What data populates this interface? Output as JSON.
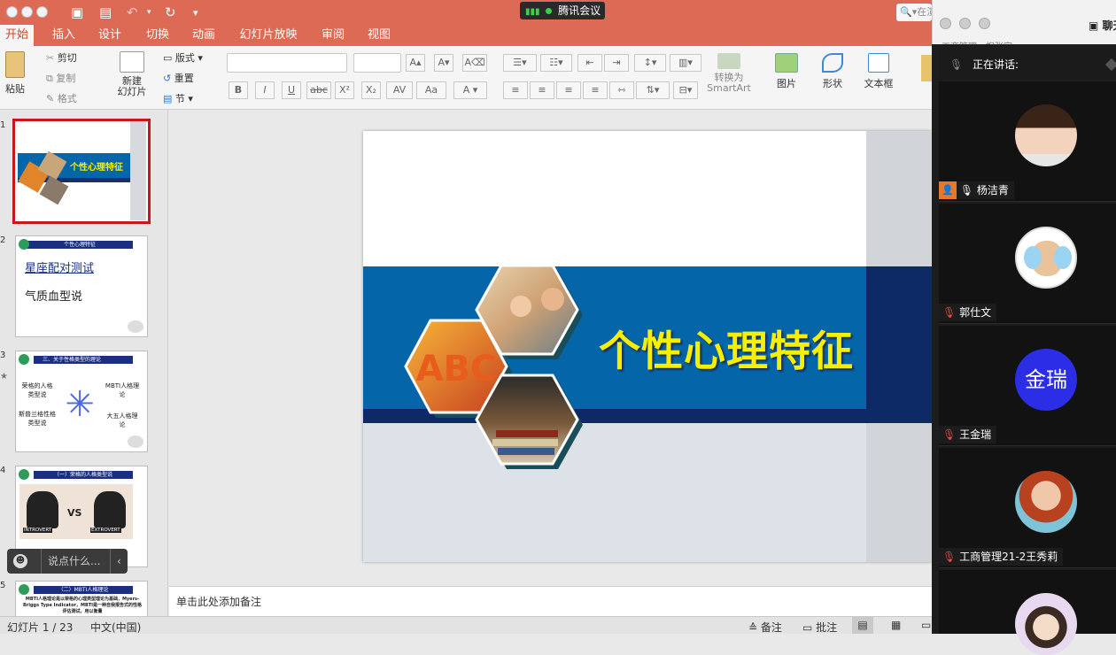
{
  "meeting": {
    "indicator_label": "腾讯会议",
    "speaking_label": "正在讲话:",
    "chat_label": "聊天",
    "search_placeholder": "在演示文稿中搜索",
    "name_strip": "工商管理 - 祝张宇"
  },
  "ribbon_tabs": [
    "开始",
    "插入",
    "设计",
    "切换",
    "动画",
    "幻灯片放映",
    "审阅",
    "视图"
  ],
  "ribbon": {
    "paste": "粘贴",
    "cut": "剪切",
    "copy": "复制",
    "format": "格式",
    "new_slide": "新建\n幻灯片",
    "layout": "版式",
    "reset": "重置",
    "section": "节",
    "convert": "转换为\nSmartArt",
    "picture": "图片",
    "shape": "形状",
    "textbox": "文本框"
  },
  "slides": [
    {
      "num": "1",
      "title": "个性心理特征"
    },
    {
      "num": "2",
      "header": "个性心理特征",
      "line1": "星座配对测试",
      "line2": "气质血型说"
    },
    {
      "num": "3",
      "header": "三、关于性格类型的理论",
      "items": [
        "荣格的人格类型说",
        "MBTI人格理论",
        "斯普兰格性格类型说",
        "大五人格理论"
      ]
    },
    {
      "num": "4",
      "header": "（一）荣格的人格类型说",
      "left": "INTROVERT",
      "right": "EXTROVERT",
      "vs": "VS"
    },
    {
      "num": "5",
      "header": "（二）MBTI人格理论",
      "body": "MBTI人格理论是以荣格的心理类型理论为基础，Myers-Briggs Type Indicator，MBTI是一种自我报告式的性格评估测试，用以衡量"
    }
  ],
  "main_slide_title": "个性心理特征",
  "chat_box_placeholder": "说点什么...",
  "notes_placeholder": "单击此处添加备注",
  "status": {
    "slide_counter": "幻灯片 1 / 23",
    "language": "中文(中国)",
    "notes_btn": "备注",
    "comments_btn": "批注"
  },
  "participants": [
    {
      "name": "杨洁青",
      "avatar_text": ""
    },
    {
      "name": "郭仕文",
      "avatar_text": ""
    },
    {
      "name": "王金瑞",
      "avatar_text": "金瑞"
    },
    {
      "name": "工商管理21-2王秀莉",
      "avatar_text": ""
    }
  ],
  "colors": {
    "accent": "#dd6a55",
    "slide_blue": "#0466a8",
    "title_yellow": "#f6f000",
    "avatar_blue": "#2b2ee6"
  }
}
